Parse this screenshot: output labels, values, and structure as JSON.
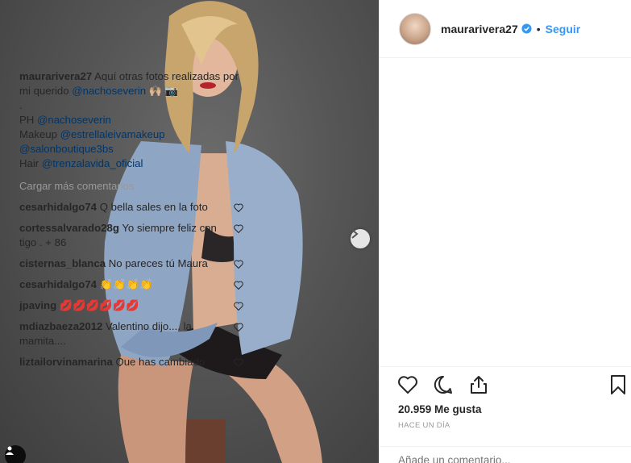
{
  "header": {
    "username": "maurarivera27",
    "separator": "•",
    "follow_label": "Seguir"
  },
  "caption": {
    "username": "maurarivera27",
    "text_1": "Aquí otras fotos realizadas por mi querido",
    "mention_1": "@nachoseverin",
    "emoji_1": "🙌🏼 📷",
    "dot_line": ".",
    "ph_label": "PH",
    "ph_mention": "@nachoseverin",
    "makeup_label": "Makeup",
    "makeup_mention": "@estrellaleivamakeup",
    "salon_mention": "@salonboutique3bs",
    "hair_label": "Hair",
    "hair_mention": "@trenzalavida_oficial"
  },
  "load_more_label": "Cargar más comentarios",
  "comments": [
    {
      "user": "cesarhidalgo74",
      "text": "Q bella sales en la foto"
    },
    {
      "user": "cortessalvarado28g",
      "text": "Yo siempre feliz con tigo . + 86"
    },
    {
      "user": "cisternas_blanca",
      "text": "No pareces tú Maura"
    },
    {
      "user": "cesarhidalgo74",
      "text": "👏👏👏👏"
    },
    {
      "user": "jpaving",
      "text": "💋💋💋💋💋💋"
    },
    {
      "user": "mdiazbaeza2012",
      "text": "Valentino dijo.... la mamita...."
    },
    {
      "user": "liztailorvinamarina",
      "text": "Que has cambiado Maura no te viene ese maquillaje para"
    }
  ],
  "likes_text": "20.959 Me gusta",
  "date_text": "HACE UN DÍA",
  "add_comment_placeholder": "Añade un comentario...",
  "colors": {
    "link": "#003569",
    "follow": "#3897f0",
    "verified": "#3897f0",
    "muted": "#999999"
  },
  "icons": [
    "heart-icon",
    "comment-icon",
    "share-icon",
    "bookmark-icon",
    "verified-badge-icon",
    "next-arrow-icon",
    "user-tag-icon"
  ]
}
